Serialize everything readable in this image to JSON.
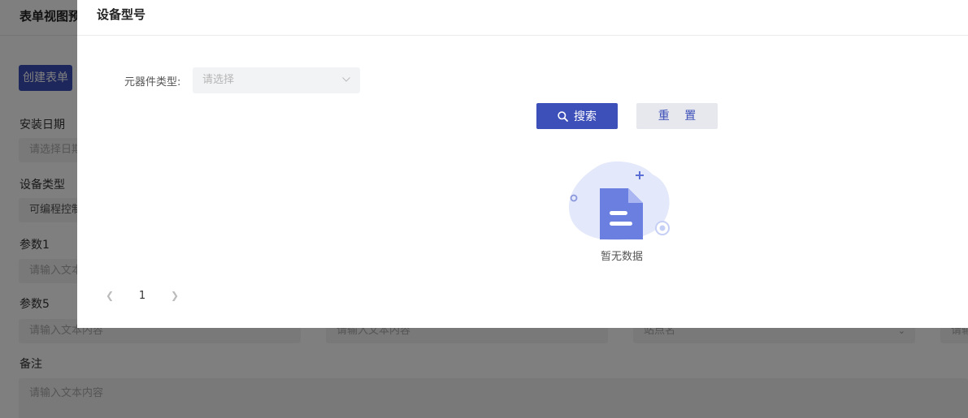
{
  "background": {
    "title": "表单视图预",
    "create_button": "创建表单",
    "fields": [
      {
        "label": "安装日期",
        "placeholder": "请选择日期"
      },
      {
        "label": "设备类型",
        "value": "可编程控制"
      },
      {
        "label": "参数1",
        "placeholder": "请输入文本"
      },
      {
        "label": "参数5",
        "placeholder": "请输入文本内容"
      }
    ],
    "row_inputs": [
      "请输入文本内容",
      "请输入文本内容",
      "站点名",
      "请输"
    ],
    "notes_label": "备注",
    "notes_placeholder": "请输入文本内容"
  },
  "modal": {
    "title": "设备型号",
    "filter_label": "元器件类型:",
    "filter_placeholder": "请选择",
    "search_label": "搜索",
    "reset_label": "重 置",
    "empty_text": "暂无数据",
    "pagination": {
      "current_page": "1"
    }
  },
  "colors": {
    "primary": "#3d4fb8",
    "input_bg": "#f2f3f5",
    "overlay": "rgba(0,0,0,0.5)"
  }
}
